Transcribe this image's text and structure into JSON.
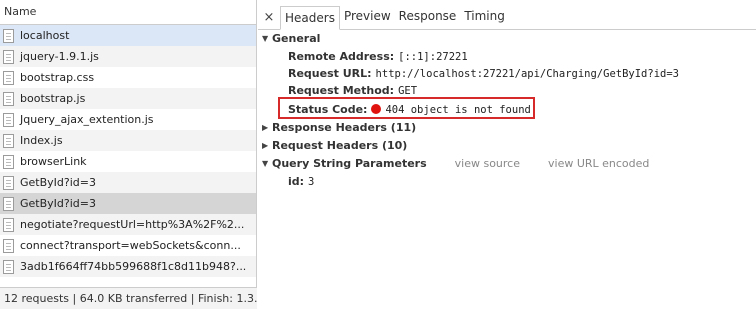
{
  "requests": {
    "header": "Name",
    "items": [
      "localhost",
      "jquery-1.9.1.js",
      "bootstrap.css",
      "bootstrap.js",
      "Jquery_ajax_extention.js",
      "Index.js",
      "browserLink",
      "GetById?id=3",
      "GetById?id=3",
      "negotiate?requestUrl=http%3A%2F%2...",
      "connect?transport=webSockets&conn...",
      "3adb1f664ff74bb599688f1c8d11b948?..."
    ],
    "footer": "12 requests | 64.0 KB transferred | Finish: 1.3..."
  },
  "tabs": {
    "close": "×",
    "headers": "Headers",
    "preview": "Preview",
    "response": "Response",
    "timing": "Timing"
  },
  "general": {
    "title": "General",
    "remote_address_label": "Remote Address:",
    "remote_address_value": "[::1]:27221",
    "request_url_label": "Request URL:",
    "request_url_value": "http://localhost:27221/api/Charging/GetById?id=3",
    "request_method_label": "Request Method:",
    "request_method_value": "GET",
    "status_code_label": "Status Code:",
    "status_code_value": "404 object is not found",
    "status_color": "#e0130f"
  },
  "response_headers": {
    "title": "Response Headers (11)"
  },
  "request_headers": {
    "title": "Request Headers (10)"
  },
  "query": {
    "title": "Query String Parameters",
    "view_source": "view source",
    "view_url_encoded": "view URL encoded",
    "param_key": "id:",
    "param_value": "3"
  },
  "colors": {
    "highlight_box": "#d62a2a",
    "selected_row": "#dbe7f7"
  }
}
